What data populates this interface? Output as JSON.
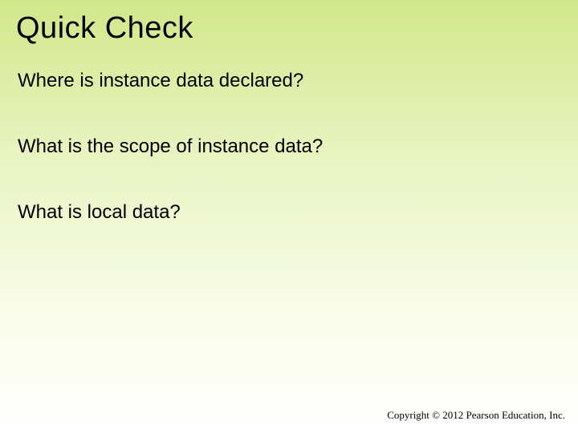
{
  "title": "Quick Check",
  "questions": [
    "Where is instance data declared?",
    "What is the scope of instance data?",
    "What is local data?"
  ],
  "copyright": "Copyright © 2012 Pearson Education, Inc."
}
